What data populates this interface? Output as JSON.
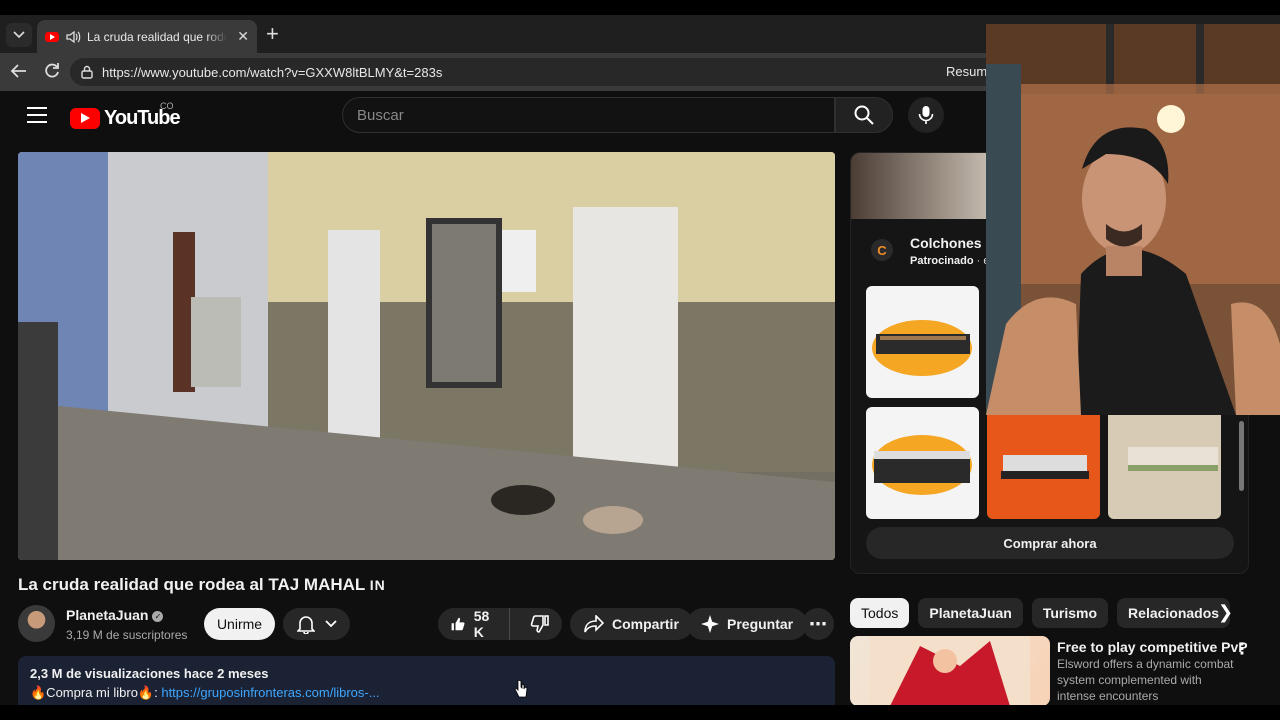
{
  "browser": {
    "tab": {
      "title": "La cruda realidad que rodea al TAJ MAHAL",
      "close": "✕"
    },
    "new_tab": "+",
    "url": "https://www.youtube.com/watch?v=GXXW8ltBLMY&t=283s",
    "right_text": "Resumi"
  },
  "youtube": {
    "logo_text": "YouTube",
    "region": "CO",
    "search": {
      "placeholder": "Buscar"
    }
  },
  "video": {
    "title": "La cruda realidad que rodea al TAJ MAHAL",
    "title_suffix": "IN",
    "channel": "PlanetaJuan",
    "subscribers": "3,19 M de suscriptores",
    "join_label": "Unirme",
    "likes": "58 K",
    "share_label": "Compartir",
    "ask_label": "Preguntar",
    "description": {
      "stats": "2,3 M de visualizaciones  hace 2 meses",
      "prefix": "🔥Compra mi libro🔥: ",
      "link": "https://gruposinfronteras.com/libros-..."
    }
  },
  "ad": {
    "advertiser": "Colchones I",
    "sponsored_label": "Patrocinado",
    "sponsored_suffix": " · e",
    "cta": "Comprar ahora"
  },
  "chips": [
    "Todos",
    "PlanetaJuan",
    "Turismo",
    "Relacionados"
  ],
  "recommendation": {
    "title": "Free to play competitive PvP",
    "description": "Elsword offers a dynamic combat system complemented with intense encounters"
  },
  "colors": {
    "yt_red": "#ff0000",
    "link_blue": "#3ea6ff",
    "background": "#0f0f0f",
    "surface": "#272727"
  }
}
